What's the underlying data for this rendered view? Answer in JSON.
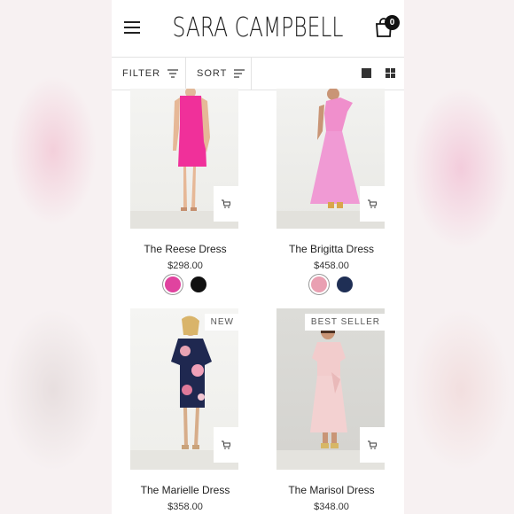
{
  "header": {
    "logo": "SARA CAMPBELL",
    "cart_count": "0"
  },
  "toolbar": {
    "filter_label": "FILTER",
    "sort_label": "SORT"
  },
  "products": [
    {
      "name": "The Reese Dress",
      "price": "$298.00",
      "badge": "",
      "swatches": [
        "#e0439f",
        "#111111"
      ],
      "dress_color": "#f0309a"
    },
    {
      "name": "The Brigitta Dress",
      "price": "$458.00",
      "badge": "",
      "swatches": [
        "#e9a0b2",
        "#1f2f55"
      ],
      "dress_color": "#f08fcc"
    },
    {
      "name": "The Marielle Dress",
      "price": "$358.00",
      "badge": "NEW",
      "swatches": [],
      "dress_color": "#1f2850"
    },
    {
      "name": "The Marisol Dress",
      "price": "$348.00",
      "badge": "BEST SELLER",
      "swatches": [],
      "dress_color": "#f2cccc"
    }
  ],
  "colors": {
    "accent": "#111111",
    "background": "#ffffff"
  }
}
